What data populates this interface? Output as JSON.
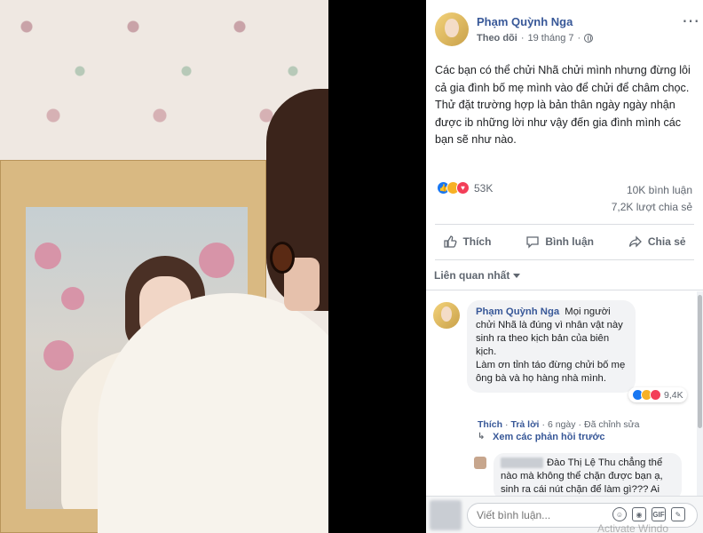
{
  "post": {
    "author": "Phạm Quỳnh Nga",
    "follow_label": "Theo dõi",
    "date": "19 tháng 7",
    "separator": "·",
    "text": "Các bạn có thể chửi Nhã chửi mình nhưng đừng lôi cả gia đình bố mẹ mình vào để chửi để châm chọc. Thử đặt trường hợp là bản thân ngày ngày nhận được ib những lời như vậy đến gia đình mình các bạn sẽ như nào."
  },
  "stats": {
    "reaction_count": "53K",
    "comment_count": "10K bình luận",
    "share_count": "7,2K lượt chia sẻ"
  },
  "actions": {
    "like": "Thích",
    "comment": "Bình luận",
    "share": "Chia sẻ"
  },
  "sort": {
    "label": "Liên quan nhất"
  },
  "comment": {
    "author": "Phạm Quỳnh Nga",
    "body": "Mọi người chửi Nhã là đúng vì nhân vật này sinh ra theo kịch bản của biên kịch.\nLàm ơn tỉnh táo đừng chửi bố mẹ ông bà và họ hàng nhà mình.",
    "reaction_count": "9,4K",
    "like": "Thích",
    "reply": "Trả lời",
    "time": "6 ngày",
    "edited": "Đã chỉnh sửa",
    "dot": "·"
  },
  "view_replies": {
    "label": "Xem các phản hồi trước"
  },
  "reply": {
    "author": "Đào Thị Lệ Thu",
    "body": "chẳng thể nào mà không thể chặn được bạn ạ, sinh ra cái nút chặn để làm gì??? Ai"
  },
  "composer": {
    "placeholder": "Viết bình luận..."
  },
  "watermark": "Activate Windo",
  "colors": {
    "link": "#385898",
    "like_blue": "#1877f2",
    "love_red": "#f33e58",
    "sad_yellow": "#f7b125"
  }
}
